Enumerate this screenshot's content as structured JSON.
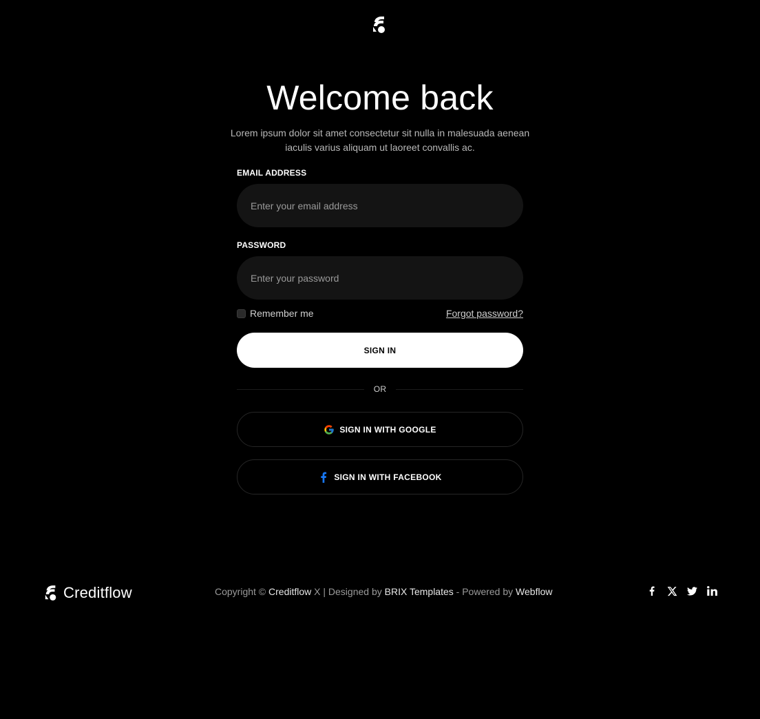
{
  "header": {
    "logo_icon": "creditflow-logo-icon"
  },
  "login": {
    "title": "Welcome back",
    "subtitle": "Lorem ipsum dolor sit amet consectetur sit nulla in malesuada aenean iaculis varius aliquam ut laoreet convallis ac.",
    "email_label": "EMAIL ADDRESS",
    "email_placeholder": "Enter your email address",
    "email_value": "",
    "password_label": "PASSWORD",
    "password_placeholder": "Enter your password",
    "password_value": "",
    "remember_label": "Remember me",
    "remember_checked": false,
    "forgot_label": "Forgot password?",
    "signin_label": "SIGN IN",
    "divider_label": "OR",
    "google_label": "SIGN IN WITH GOOGLE",
    "facebook_label": "SIGN IN WITH FACEBOOK"
  },
  "footer": {
    "brand": "Creditflow",
    "copyright_prefix": "Copyright © ",
    "copyright_brand": "Creditflow",
    "copyright_mid": " X | Designed by ",
    "designer": "BRIX Templates",
    "powered_prefix": " - Powered by ",
    "powered_by": "Webflow",
    "social_icons": [
      "facebook-icon",
      "x-icon",
      "twitter-icon",
      "linkedin-icon"
    ]
  },
  "colors": {
    "background": "#000000",
    "field_background": "#141414",
    "primary_button": "#ffffff",
    "muted_text": "#9a9a9a",
    "facebook_blue": "#1877F2"
  }
}
